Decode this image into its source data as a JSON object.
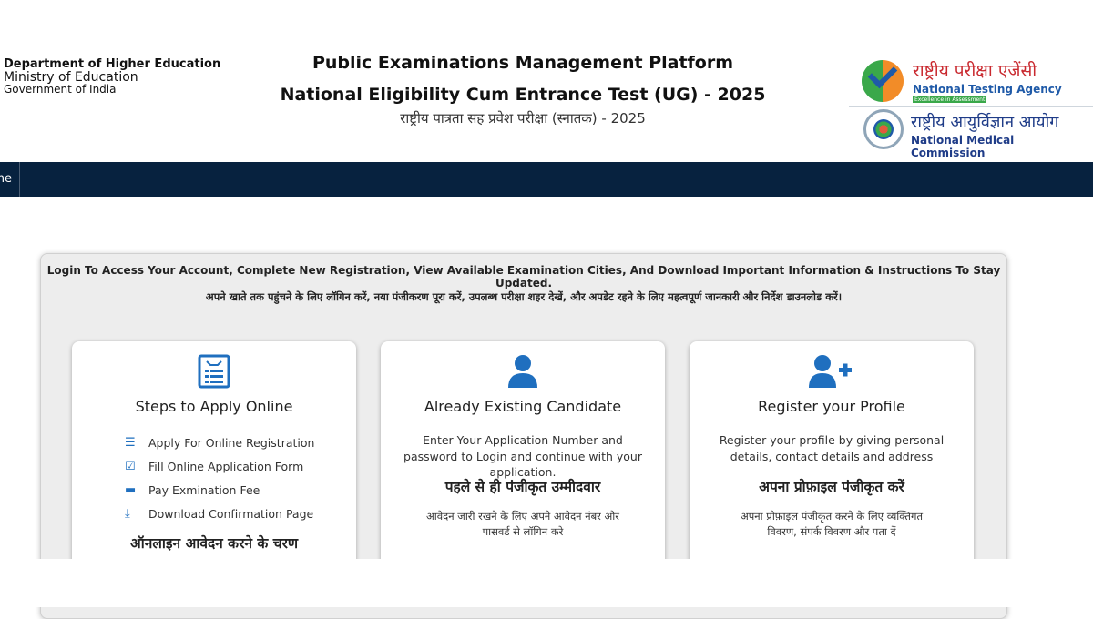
{
  "header": {
    "dept_line1": "Department of Higher Education",
    "dept_line2": "Ministry of Education",
    "dept_line3": "Government of India",
    "title": "Public Examinations Management Platform",
    "subtitle": "National Eligibility Cum Entrance Test (UG) - 2025",
    "subtitle_hindi": "राष्ट्रीय पात्रता सह प्रवेश परीक्षा (स्नातक) - 2025",
    "nta_hindi": "राष्ट्रीय परीक्षा एजेंसी",
    "nta_english": "National Testing Agency",
    "nta_tagline": "Excellence in Assessment",
    "nmc_hindi": "राष्ट्रीय आयुर्विज्ञान आयोग",
    "nmc_english": "National Medical Commission"
  },
  "nav": {
    "home_label": "Home"
  },
  "panel": {
    "intro_en": "Login To Access Your Account, Complete New Registration, View Available Examination Cities, And Download Important Information & Instructions To Stay Updated.",
    "intro_hi": "अपने खाते तक पहुंचने के लिए लॉगिन करें, नया पंजीकरण पूरा करें, उपलब्ध परीक्षा शहर देखें, और अपडेट रहने के लिए महत्वपूर्ण जानकारी और निर्देश डाउनलोड करें।"
  },
  "cards": [
    {
      "title": "Steps to Apply Online",
      "icon": "form-icon",
      "steps": [
        {
          "label": "Apply For Online Registration",
          "icon": "list-icon"
        },
        {
          "label": "Fill Online Application Form",
          "icon": "edit-icon"
        },
        {
          "label": "Pay Exmination Fee",
          "icon": "card-icon"
        },
        {
          "label": "Download Confirmation Page",
          "icon": "download-icon"
        }
      ],
      "hindi_title": "ऑनलाइन आवेदन करने के चरण"
    },
    {
      "title": "Already Existing Candidate",
      "icon": "user-icon",
      "desc": "Enter Your Application Number and password to Login and continue with your application.",
      "hindi_title": "पहले से ही पंजीकृत उम्मीदवार",
      "hindi_desc": "आवेदन जारी रखने के लिए अपने आवेदन नंबर और पासवर्ड से लॉगिन करे"
    },
    {
      "title": "Register your Profile",
      "icon": "user-plus-icon",
      "desc": "Register your profile by giving personal details, contact details and address",
      "hindi_title": "अपना प्रोफ़ाइल पंजीकृत करें",
      "hindi_desc": "अपना प्रोफ़ाइल पंजीकृत करने के लिए व्यक्तिगत विवरण, संपर्क विवरण और पता दें"
    }
  ],
  "colors": {
    "navbar": "#07223f",
    "accent_blue": "#1f6fbf",
    "panel_bg": "#ededed"
  }
}
